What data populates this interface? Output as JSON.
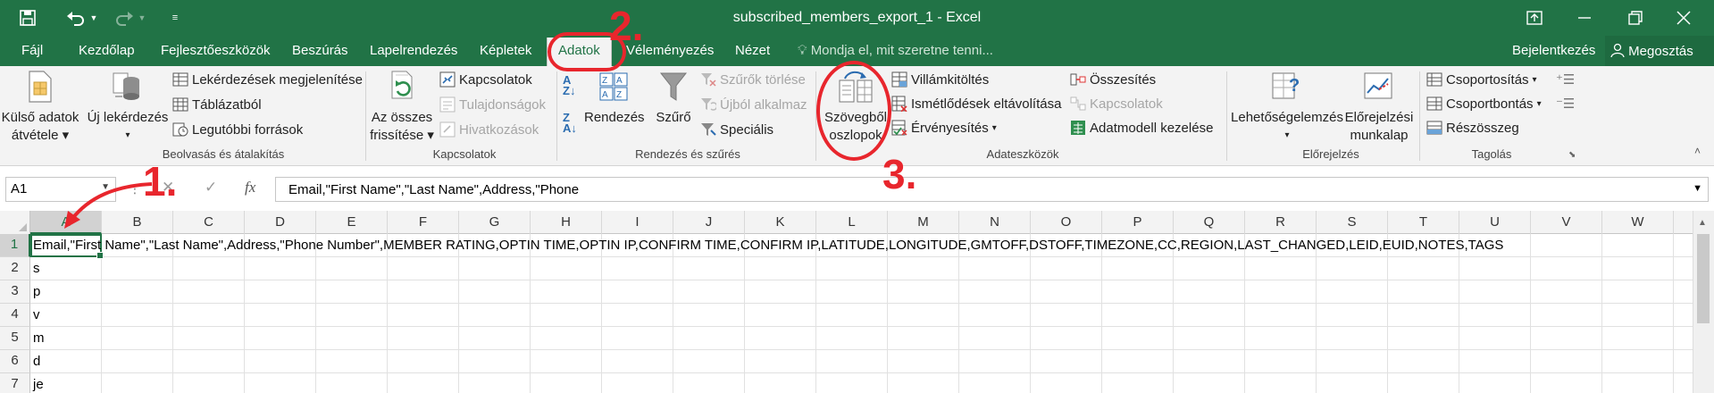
{
  "window": {
    "title": "subscribed_members_export_1 - Excel",
    "controls": [
      "Restore ribbon",
      "Minimize",
      "Maximize",
      "Close"
    ]
  },
  "qat": {
    "save": "Save",
    "undo": "Undo",
    "redo": "Redo",
    "customize": "Customize"
  },
  "tabs": [
    {
      "label": "Fájl"
    },
    {
      "label": "Kezdőlap"
    },
    {
      "label": "Fejlesztőeszközök"
    },
    {
      "label": "Beszúrás"
    },
    {
      "label": "Lapelrendezés"
    },
    {
      "label": "Képletek"
    },
    {
      "label": "Adatok",
      "active": true
    },
    {
      "label": "Véleményezés"
    },
    {
      "label": "Nézet"
    }
  ],
  "tell_me": "Mondja el, mit szeretne tenni...",
  "signin": "Bejelentkezés",
  "share": "Megosztás",
  "ribbon": {
    "external": {
      "line1": "Külső adatok",
      "line2": "átvétele"
    },
    "new_query": "Új lekérdezés",
    "show_queries": "Lekérdezések megjelenítése",
    "from_table": "Táblázatból",
    "recent_sources": "Legutóbbi források",
    "group1_label": "Beolvasás és átalakítás",
    "refresh_all": {
      "line1": "Az összes",
      "line2": "frissítése"
    },
    "connections": "Kapcsolatok",
    "properties": "Tulajdonságok",
    "edit_links": "Hivatkozások",
    "group2_label": "Kapcsolatok",
    "sort": "Rendezés",
    "filter": "Szűrő",
    "clear": "Szűrők törlése",
    "reapply": "Újból alkalmaz",
    "advanced": "Speciális",
    "group3_label": "Rendezés és szűrés",
    "text_to_columns": {
      "line1": "Szövegből",
      "line2": "oszlopok"
    },
    "flash_fill": "Villámkitöltés",
    "remove_duplicates": "Ismétlődések eltávolítása",
    "data_validation": "Érvényesítés",
    "consolidate": "Összesítés",
    "relationships": "Kapcsolatok",
    "data_model": "Adatmodell kezelése",
    "group4_label": "Adateszközök",
    "what_if": "Lehetőségelemzés",
    "forecast": {
      "line1": "Előrejelzési",
      "line2": "munkalap"
    },
    "group5_label": "Előrejelzés",
    "group_btn": "Csoportosítás",
    "ungroup_btn": "Csoportbontás",
    "subtotal": "Részösszeg",
    "group6_label": "Tagolás"
  },
  "formula_bar": {
    "name_box": "A1",
    "cancel": "✕",
    "enter": "✓",
    "fx": "fx",
    "content": "Email,\"First Name\",\"Last Name\",Address,\"Phone"
  },
  "grid": {
    "columns": [
      "A",
      "B",
      "C",
      "D",
      "E",
      "F",
      "G",
      "H",
      "I",
      "J",
      "K",
      "L",
      "M",
      "N",
      "O",
      "P",
      "Q",
      "R",
      "S",
      "T",
      "U",
      "V",
      "W"
    ],
    "rows": [
      "1",
      "2",
      "3",
      "4",
      "5",
      "6",
      "7"
    ],
    "cells": {
      "A1": "Email,\"First Name\",\"Last Name\",Address,\"Phone Number\",MEMBER  RATING,OPTIN  TIME,OPTIN  IP,CONFIRM  TIME,CONFIRM  IP,LATITUDE,LONGITUDE,GMTOFF,DSTOFF,TIMEZONE,CC,REGION,LAST_CHANGED,LEID,EUID,NOTES,TAGS",
      "A2": "s",
      "A3": "p",
      "A4": "v",
      "A5": "m",
      "A6": "d",
      "A7": "je"
    }
  },
  "annotations": {
    "step1": "1.",
    "step2": "2.",
    "step3": "3."
  },
  "colors": {
    "excel_green": "#217346",
    "annotation_red": "#e8262d"
  }
}
